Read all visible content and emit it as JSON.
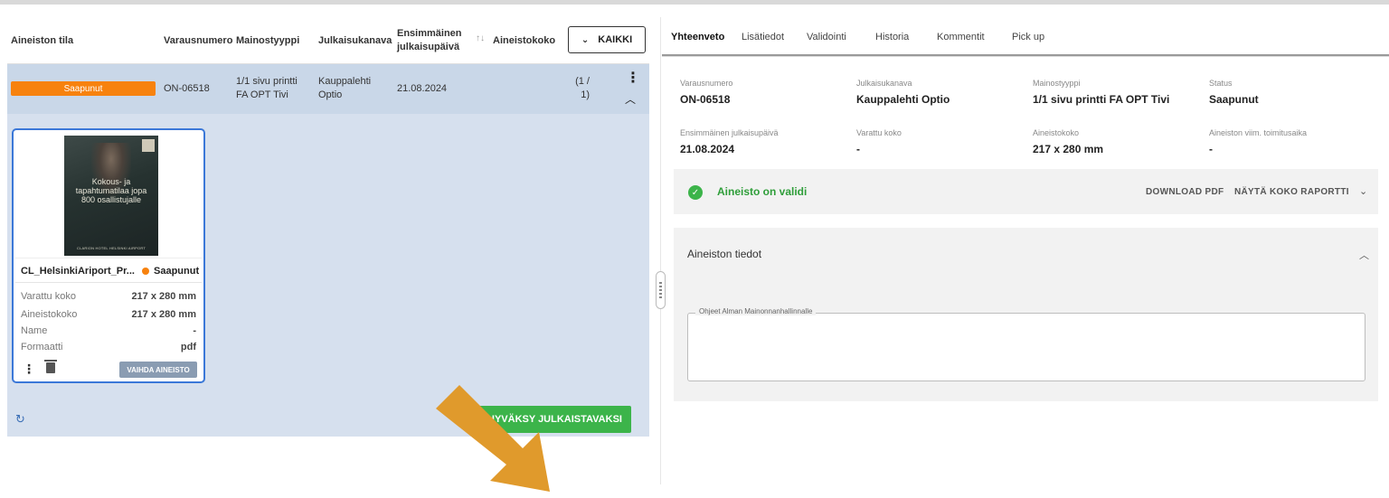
{
  "table": {
    "headers": {
      "status": "Aineiston tila",
      "booking": "Varausnumero",
      "adtype": "Mainostyyppi",
      "channel": "Julkaisukanava",
      "firstdate": "Ensimmäinen julkaisupäivä",
      "size": "Aineistokoko"
    },
    "filter_label": "KAIKKI",
    "row": {
      "status": "Saapunut",
      "booking": "ON-06518",
      "adtype": "1/1 sivu printti FA OPT Tivi",
      "channel": "Kauppalehti Optio",
      "date": "21.08.2024",
      "count": "(1 / 1)"
    }
  },
  "card": {
    "poster_text": "Kokous- ja tapahtumatilaa jopa 800 osallistujalle",
    "poster_footer": "CLARION HOTEL HELSINKI AIRPORT",
    "file_name": "CL_HelsinkiAriport_Pr...",
    "status": "Saapunut",
    "rows": [
      {
        "label": "Varattu koko",
        "value": "217 x 280 mm"
      },
      {
        "label": "Aineistokoko",
        "value": "217 x 280 mm"
      },
      {
        "label": "Name",
        "value": "-"
      },
      {
        "label": "Formaatti",
        "value": "pdf"
      }
    ],
    "change_button": "VAIHDA AINEISTO"
  },
  "approve_button": "HYVÄKSY JULKAISTAVAKSI",
  "tabs": [
    "Yhteenveto",
    "Lisätiedot",
    "Validointi",
    "Historia",
    "Kommentit",
    "Pick up"
  ],
  "summary": {
    "booking_label": "Varausnumero",
    "booking": "ON-06518",
    "channel_label": "Julkaisukanava",
    "channel": "Kauppalehti Optio",
    "adtype_label": "Mainostyyppi",
    "adtype": "1/1 sivu printti FA OPT Tivi",
    "status_label": "Status",
    "status": "Saapunut",
    "firstdate_label": "Ensimmäinen julkaisupäivä",
    "firstdate": "21.08.2024",
    "reserved_label": "Varattu koko",
    "reserved": "-",
    "size_label": "Aineistokoko",
    "size": "217 x 280 mm",
    "deadline_label": "Aineiston viim. toimitusaika",
    "deadline": "-"
  },
  "validation": {
    "text": "Aineisto on validi",
    "download": "DOWNLOAD PDF",
    "report": "NÄYTÄ KOKO RAPORTTI"
  },
  "info": {
    "title": "Aineiston tiedot",
    "field_label": "Ohjeet Alman Mainonnanhallinnalle",
    "field_value": ""
  },
  "colors": {
    "status_orange": "#f7820e",
    "approve_green": "#3cb44a",
    "row_selected": "#c9d7e8",
    "arrow": "#e09a2c"
  },
  "icons": {
    "sort": "sort-icon",
    "chevron": "chevron-down-icon",
    "kebab": "more-vert-icon",
    "refresh": "refresh-icon",
    "trash": "trash-icon",
    "check": "check-circle-icon"
  }
}
